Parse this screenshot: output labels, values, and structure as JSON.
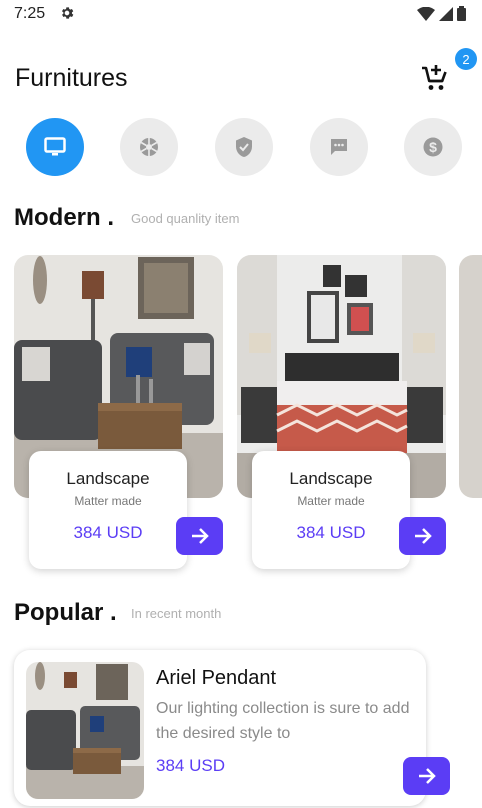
{
  "status": {
    "time": "7:25"
  },
  "header": {
    "title": "Furnitures",
    "cart_badge": "2"
  },
  "categories": [
    {
      "icon": "monitor-icon",
      "active": true
    },
    {
      "icon": "camera-aperture-icon",
      "active": false
    },
    {
      "icon": "shield-check-icon",
      "active": false
    },
    {
      "icon": "chat-icon",
      "active": false
    },
    {
      "icon": "dollar-coin-icon",
      "active": false
    }
  ],
  "modern": {
    "title": "Modern .",
    "subtitle": "Good quanlity item",
    "cards": [
      {
        "name": "Landscape",
        "maker": "Matter made",
        "price": "384 USD"
      },
      {
        "name": "Landscape",
        "maker": "Matter made",
        "price": "384 USD"
      }
    ]
  },
  "popular": {
    "title": "Popular .",
    "subtitle": "In recent month",
    "item": {
      "name": "Ariel Pendant",
      "description": "Our lighting collection is sure to add the desired style to",
      "price": "384 USD"
    }
  },
  "colors": {
    "accent_blue": "#2196f3",
    "accent_purple": "#5b3df5",
    "category_bg": "#ebebeb"
  }
}
